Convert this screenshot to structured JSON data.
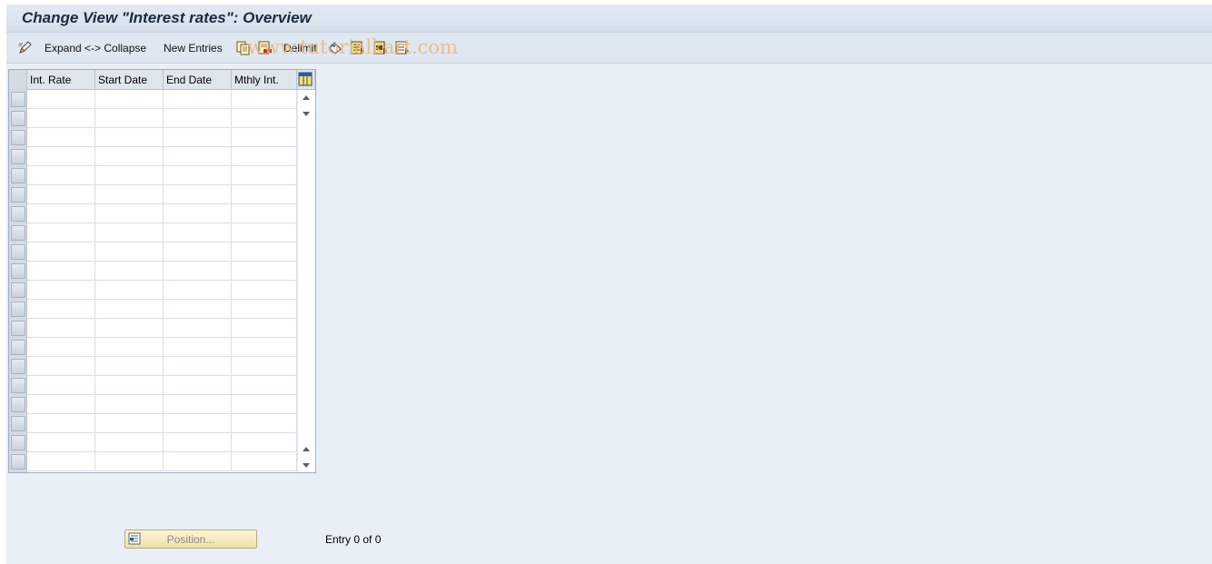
{
  "window": {
    "title": "Change View \"Interest rates\": Overview"
  },
  "toolbar": {
    "items": [
      {
        "icon": "edit-pencil-icon"
      },
      {
        "label": "Expand <-> Collapse"
      },
      {
        "label": "New Entries"
      },
      {
        "icon": "copy-icon"
      },
      {
        "icon": "delete-icon"
      },
      {
        "label": "Delimit"
      },
      {
        "icon": "undo-change-icon"
      },
      {
        "icon": "select-all-icon"
      },
      {
        "icon": "select-block-icon"
      },
      {
        "icon": "deselect-all-icon"
      }
    ],
    "watermark": "www.tutorialkart.com"
  },
  "table": {
    "columns": [
      "Int. Rate",
      "Start Date",
      "End Date",
      "Mthly Int."
    ],
    "row_count": 20,
    "settings_icon": "table-settings-icon"
  },
  "footer": {
    "position_button": "Position...",
    "entry_text": "Entry 0 of 0"
  },
  "colors": {
    "background": "#e9eff6",
    "title_text": "#1b2c3f",
    "position_button": "#f4e9b9"
  }
}
